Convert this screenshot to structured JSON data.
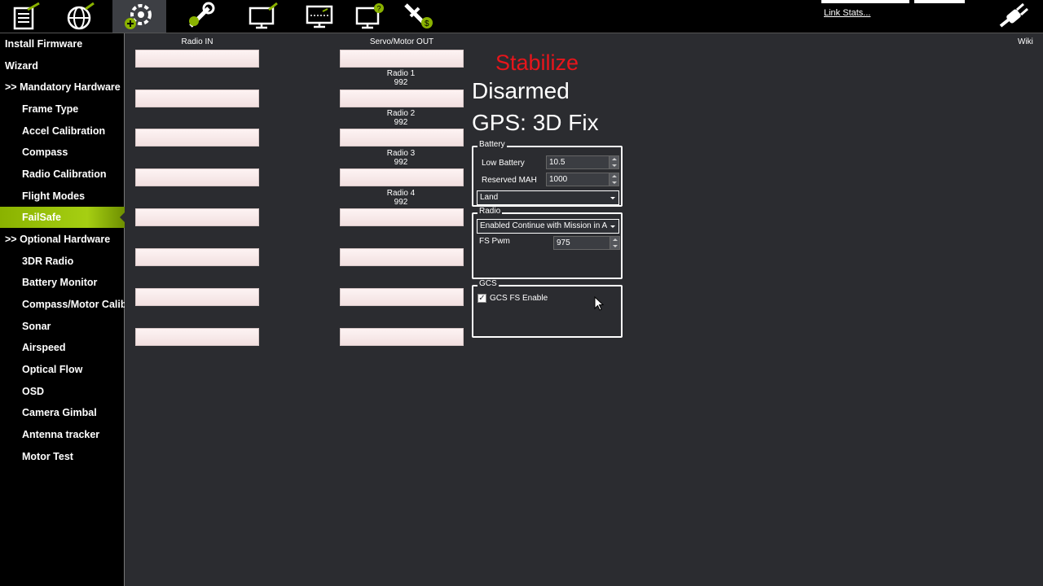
{
  "toolbar": {
    "icons": [
      "flight-data-icon",
      "flight-plan-icon",
      "initial-setup-icon",
      "config-tuning-icon",
      "simulation-icon",
      "terminal-icon",
      "help-icon",
      "donate-icon"
    ],
    "link_stats": "Link Stats...",
    "accent": "#8ab200"
  },
  "sidebar": {
    "items": [
      {
        "label": "Install Firmware"
      },
      {
        "label": "Wizard"
      },
      {
        "label": ">> Mandatory Hardware"
      },
      {
        "label": "Frame Type"
      },
      {
        "label": "Accel Calibration"
      },
      {
        "label": "Compass"
      },
      {
        "label": "Radio Calibration"
      },
      {
        "label": "Flight Modes"
      },
      {
        "label": "FailSafe"
      },
      {
        "label": ">> Optional Hardware"
      },
      {
        "label": "3DR Radio"
      },
      {
        "label": "Battery Monitor"
      },
      {
        "label": "Compass/Motor Calib"
      },
      {
        "label": "Sonar"
      },
      {
        "label": "Airspeed"
      },
      {
        "label": "Optical Flow"
      },
      {
        "label": "OSD"
      },
      {
        "label": "Camera Gimbal"
      },
      {
        "label": "Antenna tracker"
      },
      {
        "label": "Motor Test"
      }
    ],
    "active": "FailSafe"
  },
  "wiki": "Wiki",
  "channels": {
    "radio_in_title": "Radio IN",
    "servo_out_title": "Servo/Motor OUT",
    "radio_labels": [
      {
        "name": "Radio 1",
        "value": "992"
      },
      {
        "name": "Radio 2",
        "value": "992"
      },
      {
        "name": "Radio 3",
        "value": "992"
      },
      {
        "name": "Radio 4",
        "value": "992"
      }
    ]
  },
  "status": {
    "mode": "Stabilize",
    "mode_color": "#e8151b",
    "armed": "Disarmed",
    "gps": "GPS: 3D Fix"
  },
  "battery": {
    "title": "Battery",
    "low_battery_label": "Low Battery",
    "low_battery_value": "10.5",
    "reserved_mah_label": "Reserved MAH",
    "reserved_mah_value": "1000",
    "action": "Land"
  },
  "radio": {
    "title": "Radio",
    "action": "Enabled Continue with Mission in Au",
    "fs_pwm_label": "FS Pwm",
    "fs_pwm_value": "975"
  },
  "gcs": {
    "title": "GCS",
    "enable_label": "GCS FS Enable",
    "enabled": true
  }
}
